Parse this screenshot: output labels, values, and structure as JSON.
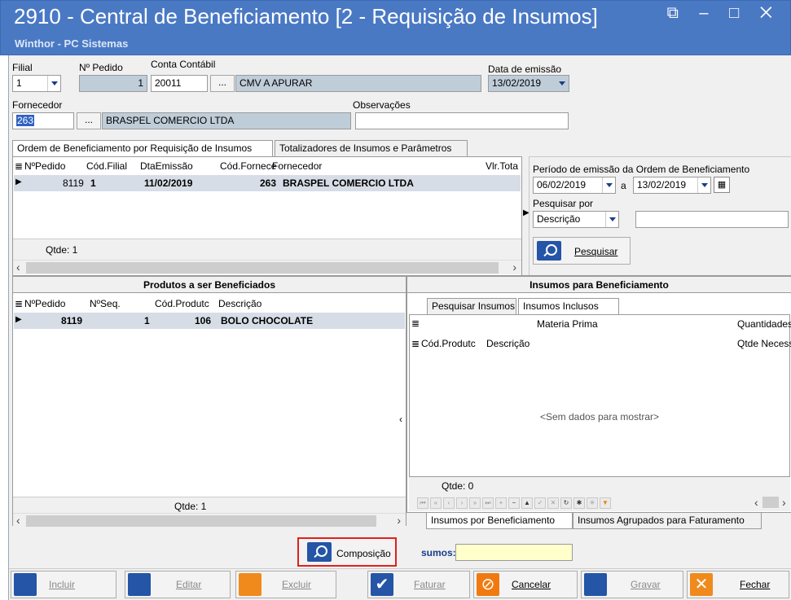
{
  "window": {
    "title": "2910 - Central de Beneficiamento [2 - Requisição de Insumos]",
    "subtitle": "Winthor - PC Sistemas",
    "controls": "⧉ – □ ✕"
  },
  "header": {
    "filial_label": "Filial",
    "filial_value": "1",
    "npedido_label": "Nº Pedido",
    "npedido_value": "1",
    "conta_label": "Conta Contábil",
    "conta_code": "20011",
    "conta_desc": "CMV A APURAR",
    "ellipsis": "...",
    "data_label": "Data de emissão",
    "data_value": "13/02/2019",
    "fornecedor_label": "Fornecedor",
    "fornecedor_code": "263",
    "fornecedor_name": "BRASPEL COMERCIO LTDA",
    "obs_label": "Observações",
    "obs_value": ""
  },
  "tabs_top": [
    {
      "label": "Ordem de Beneficiamento por Requisição de Insumos"
    },
    {
      "label": "Totalizadores de Insumos e Parâmetros"
    }
  ],
  "orders_grid": {
    "columns": [
      "NºPedido",
      "Cód.Filial",
      "DtaEmissão",
      "Cód.Fornece",
      "Fornecedor",
      "Vlr.Tota"
    ],
    "rows": [
      {
        "npedido": "8119",
        "filial": "1",
        "data": "11/02/2019",
        "cod_forn": "263",
        "fornecedor": "BRASPEL COMERCIO LTDA",
        "vlr": ""
      }
    ],
    "qtde": "Qtde: 1"
  },
  "search_panel": {
    "periodo_label": "Período de emissão da Ordem de Beneficiamento",
    "date_from": "06/02/2019",
    "a_label": "a",
    "date_to": "13/02/2019",
    "pesquisar_por_label": "Pesquisar por",
    "pesquisar_por_value": "Descrição",
    "search_value": "",
    "pesquisar_button": "Pesquisar"
  },
  "produtos_panel": {
    "title": "Produtos a ser Beneficiados",
    "columns": [
      "NºPedido",
      "NºSeq.",
      "Cód.Produtc",
      "Descrição"
    ],
    "rows": [
      {
        "npedido": "8119",
        "seq": "1",
        "cod": "106",
        "descricao": "BOLO CHOCOLATE"
      }
    ],
    "qtde": "Qtde: 1"
  },
  "insumos_panel": {
    "title": "Insumos para Beneficiamento",
    "tabs": [
      {
        "label": "Pesquisar Insumos"
      },
      {
        "label": "Insumos Inclusos"
      }
    ],
    "band_materia": "Materia Prima",
    "band_quantidades": "Quantidades",
    "columns": [
      "Cód.Produtc",
      "Descrição",
      "Qtde Necessá"
    ],
    "empty_text": "<Sem dados para mostrar>",
    "qtde": "Qtde: 0",
    "bottom_tabs": [
      {
        "label": "Insumos por Beneficiamento"
      },
      {
        "label": "Insumos Agrupados para Faturamento"
      }
    ]
  },
  "composicao_button": "Composição",
  "insumos_total_label": "sumos:",
  "insumos_total_value": "",
  "toolbar": {
    "incluir": "Incluir",
    "editar": "Editar",
    "excluir": "Excluir",
    "faturar": "Faturar",
    "cancelar": "Cancelar",
    "gravar": "Gravar",
    "fechar": "Fechar"
  },
  "colors": {
    "titlebar": "#4a79c4",
    "highlight_border": "#e02020",
    "accent_blue": "#2455a6",
    "fechar_orange": "#f08a1c",
    "cancelar_orange": "#f07a10"
  }
}
